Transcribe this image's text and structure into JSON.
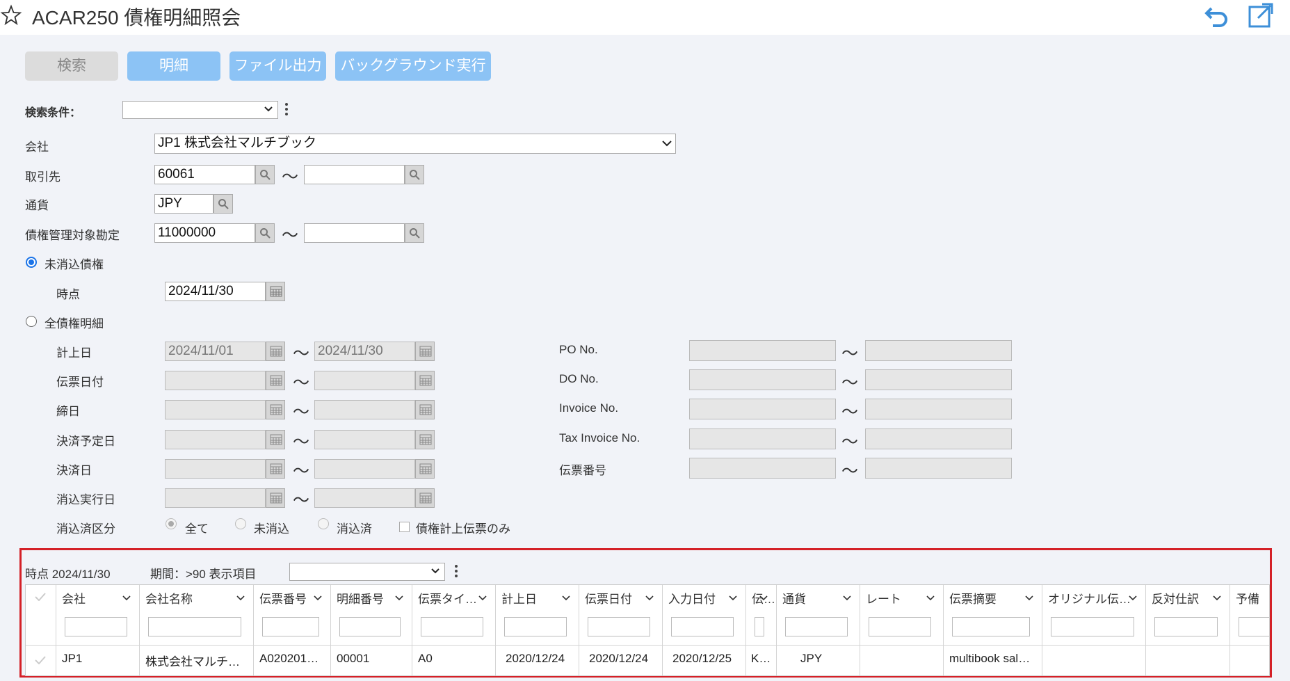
{
  "header": {
    "title": "ACAR250 債権明細照会"
  },
  "toolbar": {
    "search": "検索",
    "detail": "明細",
    "file_output": "ファイル出力",
    "background": "バックグラウンド実行"
  },
  "form": {
    "search_condition_label": "検索条件：",
    "search_condition_value": "",
    "company_label": "会社",
    "company_value": "JP1 株式会社マルチブック",
    "partner_label": "取引先",
    "partner_from": "60061",
    "partner_to": "",
    "currency_label": "通貨",
    "currency_value": "JPY",
    "account_label": "債権管理対象勘定",
    "account_from": "11000000",
    "account_to": "",
    "tilde": "～",
    "radio_uncleared": "未消込債権",
    "as_of_label": "時点",
    "as_of_value": "2024/11/30",
    "radio_all": "全債権明細",
    "posting_date_label": "計上日",
    "posting_from": "2024/11/01",
    "posting_to": "2024/11/30",
    "slip_date_label": "伝票日付",
    "closing_date_label": "締日",
    "due_date_label": "決済予定日",
    "settle_date_label": "決済日",
    "clear_exec_label": "消込実行日",
    "clear_status_label": "消込済区分",
    "opt_all": "全て",
    "opt_uncleared": "未消込",
    "opt_cleared": "消込済",
    "chk_receivable_only": "債権計上伝票のみ",
    "po_label": "PO No.",
    "do_label": "DO No.",
    "invoice_label": "Invoice No.",
    "tax_invoice_label": "Tax Invoice No.",
    "slip_no_label": "伝票番号"
  },
  "results": {
    "as_of": "時点 2024/11/30",
    "period": "期間：>90 表示項目",
    "display_value": ""
  },
  "grid": {
    "columns": [
      "会社",
      "会社名称",
      "伝票番号",
      "明細番号",
      "伝票タイ…",
      "計上日",
      "伝票日付",
      "入力日付",
      "伝…",
      "通貨",
      "レート",
      "伝票摘要",
      "オリジナル伝…",
      "反対仕訳",
      "予備"
    ],
    "rows": [
      [
        "JP1",
        "株式会社マルチ…",
        "A020201…",
        "00001",
        "A0",
        "2020/12/24",
        "2020/12/24",
        "2020/12/25",
        "K…",
        "JPY",
        "",
        "multibook sal…",
        "",
        "",
        ""
      ]
    ]
  },
  "colors": {
    "accent_button": "#8cc3f5",
    "highlight_border": "#d42027",
    "radio_selected": "#1a73e8"
  }
}
